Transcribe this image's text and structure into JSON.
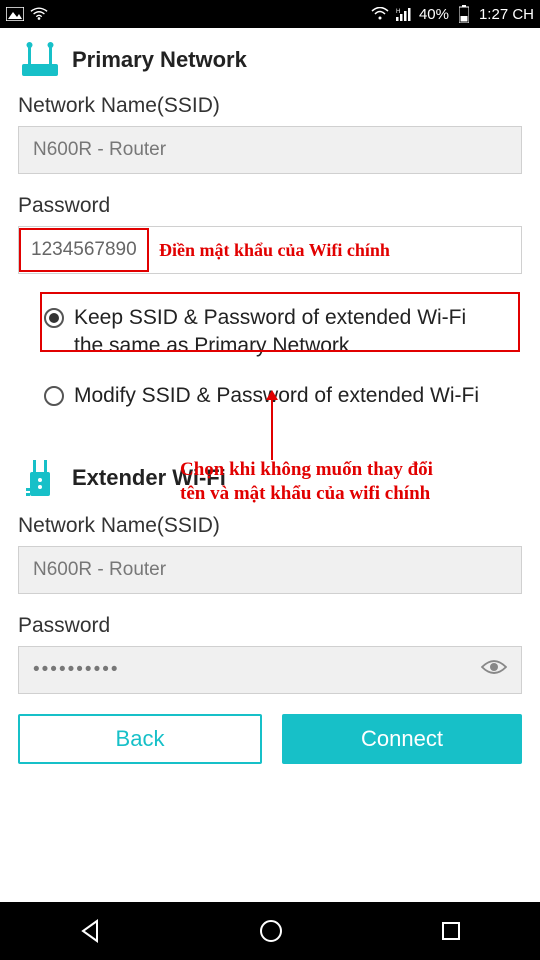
{
  "statusbar": {
    "battery": "40%",
    "time": "1:27 CH"
  },
  "primary": {
    "title": "Primary Network",
    "ssid_label": "Network Name(SSID)",
    "ssid_value": "N600R - Router",
    "password_label": "Password",
    "password_value": "1234567890"
  },
  "annotations": {
    "pw_anno": "Điền mật khẩu của Wifi chính",
    "choice_anno_l1": "Chọn khi không muốn thay đổi",
    "choice_anno_l2": "tên và mật khẩu của wifi chính"
  },
  "options": {
    "keep": "Keep SSID & Password of extended Wi-Fi the same as Primary Network",
    "modify": "Modify SSID & Password of extended Wi-Fi"
  },
  "extender": {
    "title": "Extender Wi-Fi",
    "ssid_label": "Network Name(SSID)",
    "ssid_value": "N600R - Router",
    "password_label": "Password",
    "password_value": "••••••••••"
  },
  "buttons": {
    "back": "Back",
    "connect": "Connect"
  }
}
